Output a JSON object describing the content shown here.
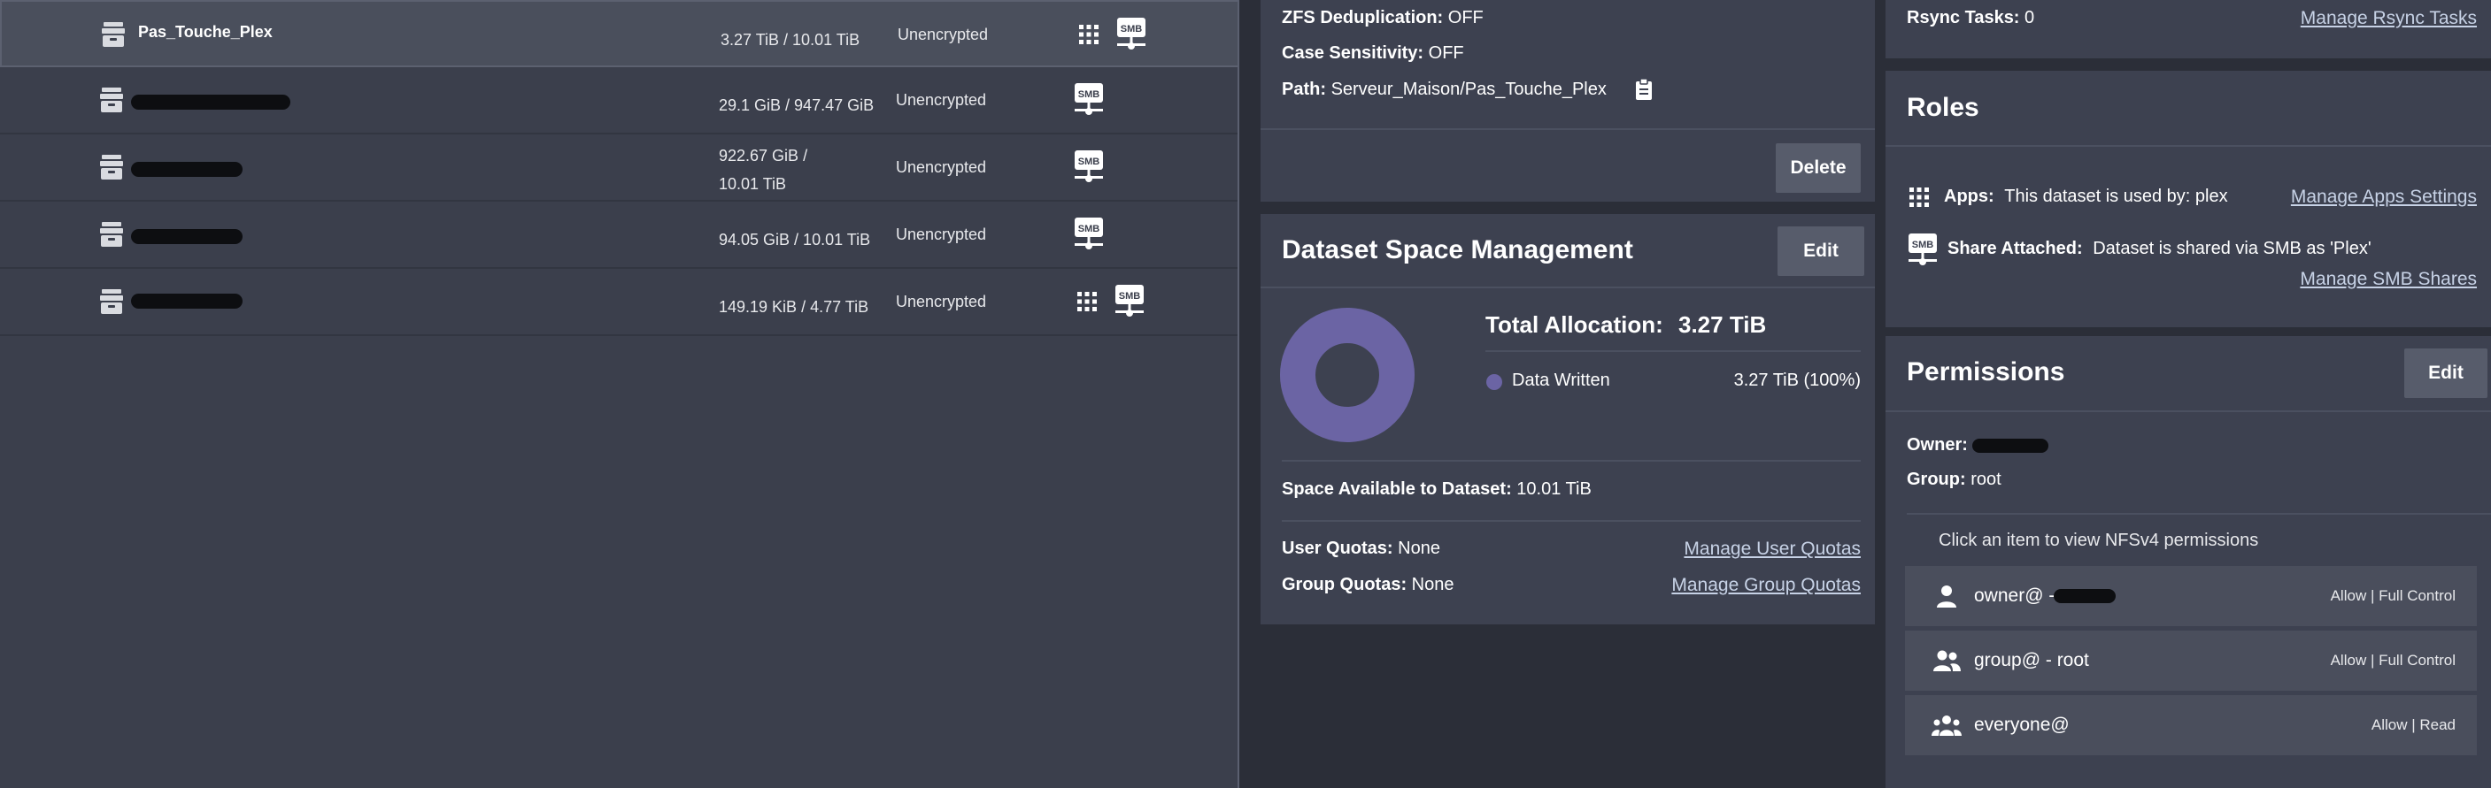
{
  "datasets": [
    {
      "name": "Pas_Touche_Plex",
      "used": "3.27 TiB / 10.01 TiB",
      "encryption": "Unencrypted",
      "apps": true,
      "smb": true
    },
    {
      "name": "",
      "used": "29.1 GiB / 947.47 GiB",
      "encryption": "Unencrypted",
      "apps": false,
      "smb": true
    },
    {
      "name": "",
      "used_line1": "922.67 GiB /",
      "used_line2": "10.01 TiB",
      "encryption": "Unencrypted",
      "apps": false,
      "smb": true
    },
    {
      "name": "",
      "used": "94.05 GiB / 10.01 TiB",
      "encryption": "Unencrypted",
      "apps": false,
      "smb": true
    },
    {
      "name": "",
      "used": "149.19 KiB / 4.77 TiB",
      "encryption": "Unencrypted",
      "apps": true,
      "smb": true
    }
  ],
  "details": {
    "dedup_label": "ZFS Deduplication:",
    "dedup_value": "OFF",
    "case_label": "Case Sensitivity:",
    "case_value": "OFF",
    "path_label": "Path:",
    "path_value": "Serveur_Maison/Pas_Touche_Plex",
    "delete_button": "Delete"
  },
  "space": {
    "title": "Dataset Space Management",
    "edit_button": "Edit",
    "total_label": "Total Allocation:",
    "total_value": "3.27 TiB",
    "legend_label": "Data Written",
    "legend_value": "3.27 TiB (100%)",
    "donut_fraction": 1.0,
    "donut_color": "#6b64a4",
    "available_label": "Space Available to Dataset:",
    "available_value": "10.01 TiB",
    "user_quotas_label": "User Quotas:",
    "user_quotas_value": "None",
    "user_quotas_link": "Manage User Quotas",
    "group_quotas_label": "Group Quotas:",
    "group_quotas_value": "None",
    "group_quotas_link": "Manage Group Quotas"
  },
  "rsync": {
    "label": "Rsync Tasks:",
    "value": "0",
    "link": "Manage Rsync Tasks"
  },
  "roles": {
    "title": "Roles",
    "apps_label": "Apps:",
    "apps_value": "This dataset is used by: plex",
    "apps_link": "Manage Apps Settings",
    "share_label": "Share Attached:",
    "share_value": "Dataset is shared via SMB as 'Plex'",
    "share_link": "Manage SMB Shares"
  },
  "permissions": {
    "title": "Permissions",
    "edit_button": "Edit",
    "owner_label": "Owner:",
    "owner_value": "",
    "group_label": "Group:",
    "group_value": "root",
    "hint": "Click an item to view NFSv4 permissions",
    "entries": [
      {
        "who": "owner@ - ",
        "access": "Allow | Full Control",
        "icon": "person-icon"
      },
      {
        "who": "group@ - root",
        "access": "Allow | Full Control",
        "icon": "group-icon"
      },
      {
        "who": "everyone@",
        "access": "Allow | Read",
        "icon": "everyone-icon"
      }
    ]
  },
  "icons": {
    "smb_label": "SMB"
  }
}
